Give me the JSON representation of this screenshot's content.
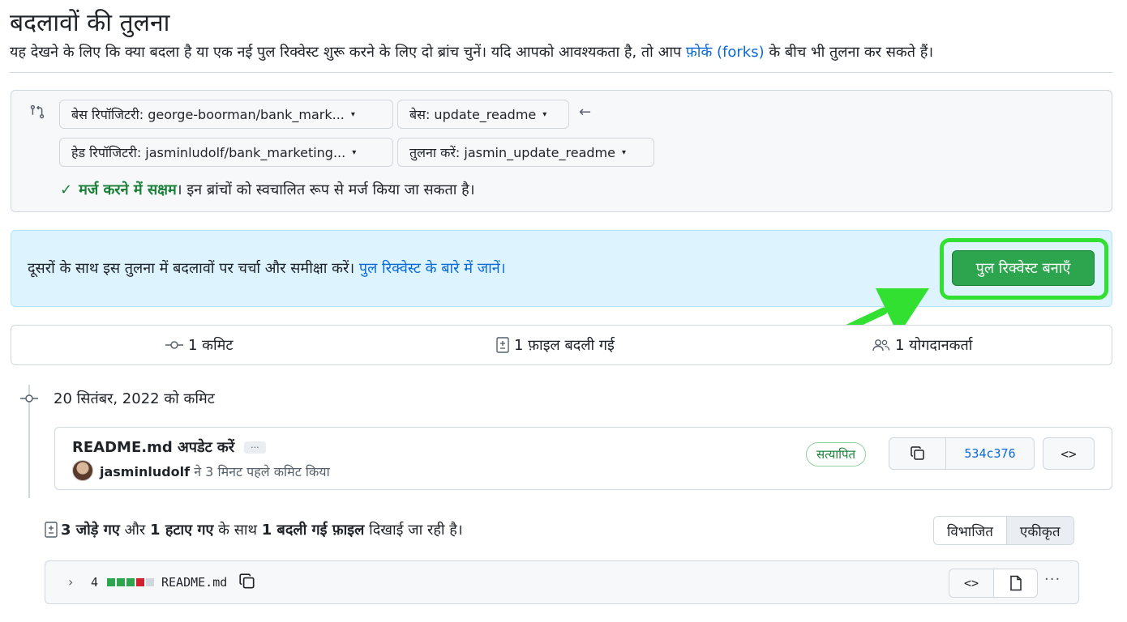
{
  "header": {
    "title": "बदलावों की तुलना",
    "description_before": "यह देखने के लिए कि क्या बदला है या एक नई पुल रिक्वेस्ट शुरू करने के लिए दो ब्रांच चुनें। यदि आपको आवश्यकता है, तो आप ",
    "description_link": "फ़ोर्क (forks)",
    "description_after": " के बीच भी तुलना कर सकते हैं।"
  },
  "range": {
    "base_repo": "बेस रिपॉजिटरी: george-boorman/bank_mark...",
    "base_branch": "बेस: update_readme",
    "head_repo": "हेड रिपॉजिटरी: jasminludolf/bank_marketing...",
    "compare_branch": "तुलना करें: jasmin_update_readme",
    "merge_status": "मर्ज करने में सक्षम",
    "merge_text": "। इन ब्रांचों को स्वचालित रूप से मर्ज किया जा सकता है।",
    "caret": "▾",
    "arrow": "←",
    "check": "✓"
  },
  "info": {
    "text": "दूसरों के साथ इस तुलना में बदलावों पर चर्चा और समीक्षा करें। ",
    "link": "पुल रिक्वेस्ट के बारे में जानें।",
    "create_pr": "पुल रिक्वेस्ट बनाएँ"
  },
  "stats": {
    "commits": "1 कमिट",
    "files_changed": "1 फ़ाइल बदली गई",
    "contributors": "1 योगदानकर्ता"
  },
  "commit_group": {
    "date": "20 सितंबर, 2022 को कमिट",
    "commit": {
      "title": "README.md अपडेट करें",
      "ellipsis": "···",
      "author": "jasminludolf",
      "author_suffix": " ने 3 मिनट पहले कमिट किया",
      "verified": "सत्यापित",
      "sha": "534c376",
      "browse": "<>"
    }
  },
  "diff_summary": {
    "added": "3 जोड़े गए",
    "and": " और ",
    "removed": "1 हटाए गए",
    "with": " के साथ ",
    "changed_files": "1 बदली गई फ़ाइल",
    "showing": " दिखाई जा रही है।",
    "split": "विभाजित",
    "unified": "एकीकृत"
  },
  "file": {
    "chevron": "›",
    "count": "4",
    "name": "README.md",
    "code": "<>",
    "more": "···"
  },
  "colors": {
    "green": "#2da44e",
    "link": "#0969da",
    "highlight": "#32e032",
    "info_bg": "#ddf4ff"
  }
}
